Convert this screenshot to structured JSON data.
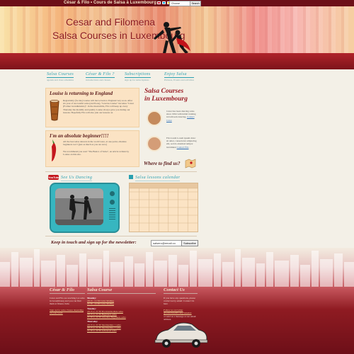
{
  "topbar": {
    "site_title": "César & Filo • Cours de Salsa à Luxembourg",
    "language_select": "Choose language",
    "search_button": "Search"
  },
  "header": {
    "title_line1": "Cesar and Filomena",
    "title_line2": "Salsa Courses in Luxembourg"
  },
  "nav": [
    {
      "title": "Salsa Courses",
      "subtitle": "agenda and class schedules"
    },
    {
      "title": "César & Filo ?",
      "subtitle": "introductions and classes"
    },
    {
      "title": "Subscriptions",
      "subtitle": "sign up for subscriptions"
    },
    {
      "title": "Enjoy Salsa",
      "subtitle": "Pictures, Events and activities"
    }
  ],
  "news1": {
    "title": "Louise is returning to England",
    "text": "Regrettably (for me) Louise will move back to England very soon. After six year of successful salsa (and fiona), \"Gracias Louise\" becomes \"César (Former Grandkinsists)\". In the meanwhile, Filo will keep up every Thursday the monthly and quality Louise always gave you during our lessons. Hopefully Filo will also join our lessons on"
  },
  "news2": {
    "title": "I'm an absolute beginner!!!!",
    "text1": "All the best salsa dancers in the world were, at one point, absolute beginners too!! (just as much as you are now)",
    "text2": "We recommend you read \"The Basics of Salsa\", an article written by Louise on this site."
  },
  "right": {
    "title_line1": "Salsa Courses",
    "title_line2": "in Luxembourg",
    "person1_text": "César has been dancing salsa since 1994 with initial training in ballroom dancing.",
    "person1_link": "Contact César",
    "person2_text": "Filo lorem Lorem ipsum dolor sit amet, consectetur adipiscing elit, sed do eiusmod tempor incididunt",
    "person2_link": "Contact Filo",
    "where": "Where to find us?"
  },
  "sections": {
    "youtube_label": "YouTube",
    "see_us": "See Us Dancing",
    "calendar": "Salsa lessons calendar"
  },
  "newsletter": {
    "label": "Keep in touch and sign up for the newsletter:",
    "email_value": "salsero@email.co",
    "subscribe": "Subscribe"
  },
  "footer": {
    "col1": {
      "title": "César & Filo",
      "text": "César and Filo are teaching LA salsa in Luxembourg and you can find them at fitness clubs",
      "link": "Sign up for salsa classes depending on your level."
    },
    "col2": {
      "title": "Salsa Course",
      "days": [
        {
          "day": "Monday:",
          "lines": [
            "20:15 - 21:30 Cuba Mailing",
            "21:30 - 22:00 Cuba Mailing"
          ]
        },
        {
          "day": "Tuesday:",
          "lines": [
            "20:15 to 21:30 Pre-Intermediate salsa",
            "20:15 to 21:30 Beginners salsa",
            "21:30 to 22:30 Absolute Beginners salsa"
          ]
        },
        {
          "day": "Thursday:",
          "lines": [
            "20:15 to 21:30 Intermediate 1 salsa",
            "20:15 to 21:30 Intermediate 2 salsa",
            "21:30 to 22:30 Advanced salsa"
          ]
        }
      ]
    },
    "col3": {
      "title": "Contact Us",
      "text": "If you have any questions, please contact us by email: Contact Us here",
      "follow": "Follow us on twitter @salsinluxembourg/Salsalux",
      "email": "or send us a message at our email address."
    }
  },
  "colors": {
    "maroon": "#6d0f18",
    "accent_teal": "#2aa0b0",
    "box_peach": "#fbe3c4",
    "title_red": "#9b1c24"
  }
}
